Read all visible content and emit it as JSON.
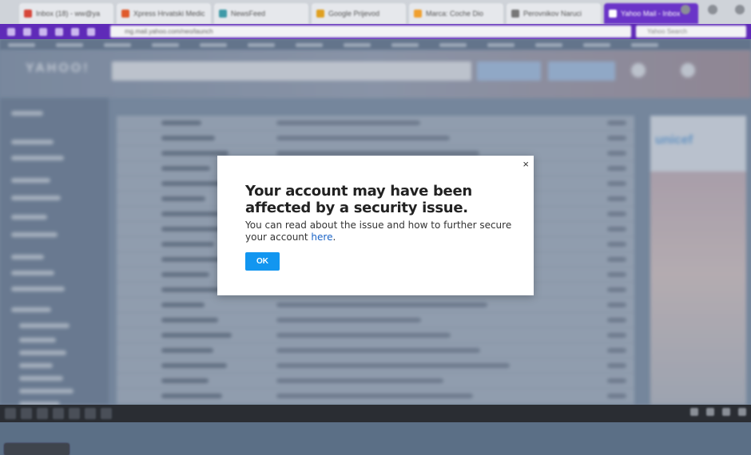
{
  "browser": {
    "tabs": [
      {
        "label": "Inbox (18) - ww@ya",
        "color": "#d6463a"
      },
      {
        "label": "Xpress Hrvatski Medic",
        "color": "#e05a2b"
      },
      {
        "label": "NewsFeed",
        "color": "#3f9aa8"
      },
      {
        "label": "Google Prijevod",
        "color": "#e0a020"
      },
      {
        "label": "Marca: Coche Dio",
        "color": "#f0a030"
      },
      {
        "label": "Perovnikov Naruci",
        "color": "#777777"
      },
      {
        "label": "Yahoo Mail - Inbox",
        "color": "#ffffff"
      }
    ],
    "url": "mg.mail.yahoo.com/neo/launch",
    "search_placeholder": "Yahoo Search"
  },
  "mail": {
    "logo": "YAHOO!",
    "unicef_label": "unicef"
  },
  "dialog": {
    "close_symbol": "×",
    "title": "Your account may have been affected by a security issue.",
    "body_text": "You can read about the issue and how to further secure your account ",
    "link_text": "here",
    "body_end": ".",
    "ok_label": "OK"
  },
  "colors": {
    "accent": "#6a34c8",
    "ok_button": "#1296f0",
    "link": "#1a63c6"
  }
}
